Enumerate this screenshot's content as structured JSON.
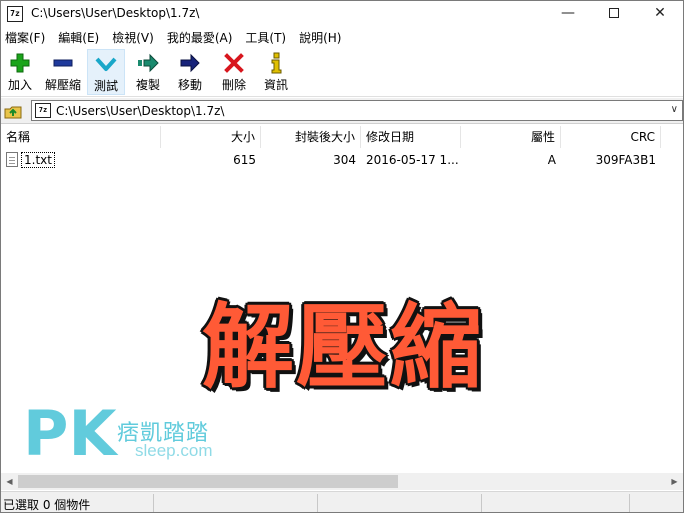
{
  "window": {
    "title": "C:\\Users\\User\\Desktop\\1.7z\\",
    "app_icon_text": "7z"
  },
  "menu": [
    "檔案(F)",
    "編輯(E)",
    "檢視(V)",
    "我的最愛(A)",
    "工具(T)",
    "說明(H)"
  ],
  "toolbar": {
    "add": "加入",
    "extract": "解壓縮",
    "test": "測試",
    "copy": "複製",
    "move": "移動",
    "delete": "刪除",
    "info": "資訊"
  },
  "address": {
    "path": "C:\\Users\\User\\Desktop\\1.7z\\",
    "icon_text": "7z"
  },
  "columns": {
    "name": "名稱",
    "size": "大小",
    "packed": "封裝後大小",
    "modified": "修改日期",
    "attributes": "屬性",
    "crc": "CRC"
  },
  "files": [
    {
      "name": "1.txt",
      "size": "615",
      "packed": "304",
      "modified": "2016-05-17 1...",
      "attributes": "A",
      "crc": "309FA3B1"
    }
  ],
  "overlay": {
    "title": "解壓縮",
    "logo_pk": "PK",
    "logo_cn": "痞凱踏踏",
    "logo_url": "sleep.com"
  },
  "status": {
    "selected": "已選取 0 個物件"
  },
  "colors": {
    "overlay_text": "#ff5a36",
    "logo": "#46c3d6",
    "add_icon": "#1aa41a",
    "extract_icon": "#1f3a9c",
    "test_icon": "#19a7c9",
    "copy_icon": "#1a8a6e",
    "move_icon": "#17237a",
    "delete_icon": "#d8161e",
    "info_icon": "#e0c000"
  }
}
